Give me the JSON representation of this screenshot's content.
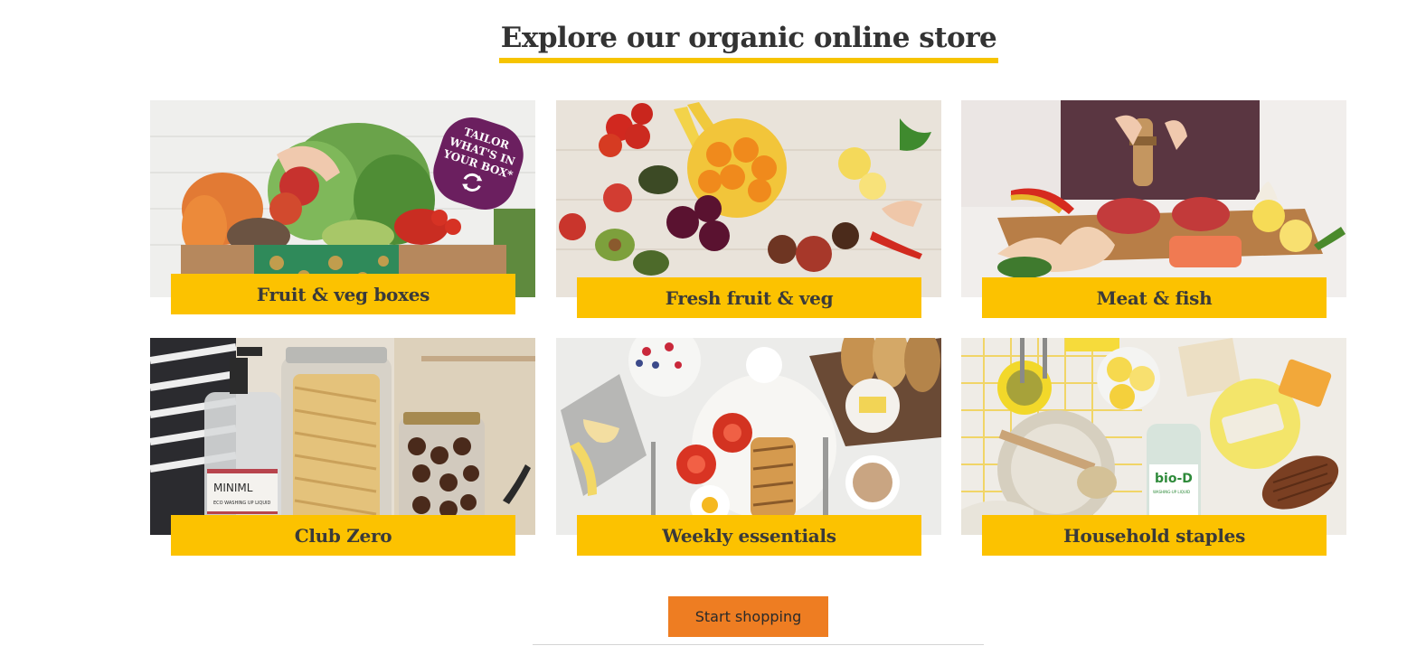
{
  "section": {
    "title": "Explore our organic online store"
  },
  "tiles": [
    {
      "label": "Fruit & veg boxes",
      "badge": "TAILOR WHAT'S IN YOUR BOX*",
      "badge_lines": [
        "TAILOR",
        "WHAT'S IN",
        "YOUR BOX*"
      ]
    },
    {
      "label": "Fresh fruit & veg"
    },
    {
      "label": "Meat & fish"
    },
    {
      "label": "Club Zero",
      "product_brand": "MINIML",
      "product_text": "ECO WASHING UP LIQUID"
    },
    {
      "label": "Weekly essentials"
    },
    {
      "label": "Household staples",
      "product_brand": "bio-D",
      "product_text": "WASHING-UP LIQUID"
    }
  ],
  "cta": {
    "label": "Start shopping"
  },
  "colors": {
    "accent": "#fcc200",
    "cta": "#ee7d22",
    "badge": "#6b1f5f",
    "text": "#333333"
  }
}
